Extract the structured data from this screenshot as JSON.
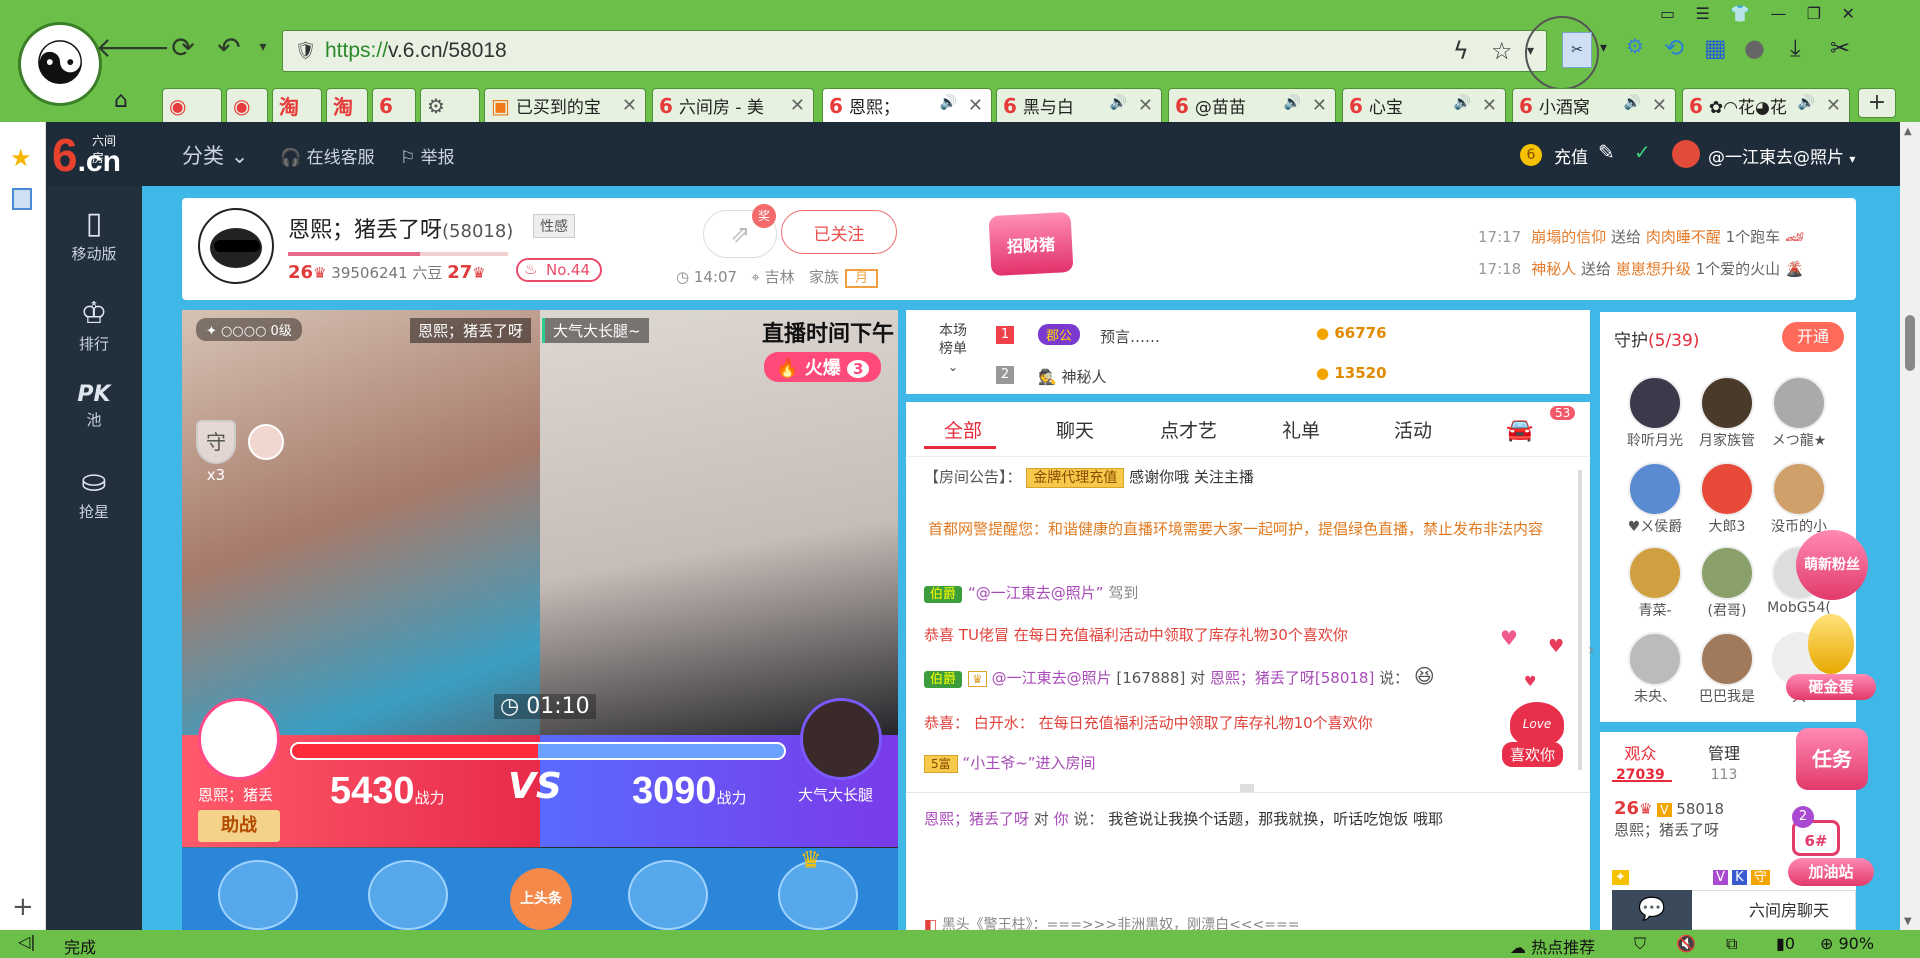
{
  "browser": {
    "url_scheme": "https://",
    "url_host": "v.6.cn/58018",
    "tabs": [
      {
        "label": "",
        "icon": "weibo-icon"
      },
      {
        "label": "",
        "icon": "weibo-icon"
      },
      {
        "label": "",
        "icon": "taobao-icon"
      },
      {
        "label": "",
        "icon": "taobao-icon"
      },
      {
        "label": "",
        "icon": "six-icon"
      },
      {
        "label": "",
        "icon": "gear-icon"
      },
      {
        "label": "已买到的宝",
        "icon": "cart-icon"
      },
      {
        "label": "六间房 - 美",
        "icon": "six-icon"
      },
      {
        "label": "恩熙；",
        "icon": "six-icon",
        "active": true
      },
      {
        "label": "黑与白",
        "icon": "six-icon"
      },
      {
        "label": "@苗苗",
        "icon": "six-icon"
      },
      {
        "label": "心宝",
        "icon": "six-icon"
      },
      {
        "label": "小酒窝",
        "icon": "six-icon"
      },
      {
        "label": "✿◠花◕花",
        "icon": "six-icon"
      }
    ],
    "new_tab": "+",
    "status_left": "完成",
    "status_hot": "热点推荐",
    "status_count": "0",
    "zoom": "90%"
  },
  "site": {
    "logo_six": "6",
    "logo_cn": ".cn",
    "logo_sub": "六间房",
    "category": "分类",
    "service": "在线客服",
    "report": "举报",
    "recharge": "充值",
    "username": "@一江東去@照片"
  },
  "left_nav": [
    {
      "label": "移动版",
      "icon": "mobile-icon"
    },
    {
      "label": "排行",
      "icon": "crown-icon"
    },
    {
      "label": "池",
      "icon": "pk-icon",
      "top": "PK"
    },
    {
      "label": "抢星",
      "icon": "bag-icon"
    }
  ],
  "anchor": {
    "name": "恩熙；猪丢了呀",
    "room_id": "(58018)",
    "tag": "性感",
    "level_num": "26",
    "beans": "39506241 六豆",
    "level2": "27",
    "rank": "No.44",
    "share_badge": "奖",
    "follow": "已关注",
    "time": "14:07",
    "location": "吉林",
    "family_label": "家族",
    "family": "月",
    "zhaocai": "招财猪"
  },
  "gift_feed": [
    {
      "time": "17:17",
      "from": "崩塌的信仰",
      "verb": "送给",
      "to": "肉肉睡不醒",
      "gift": "1个跑车"
    },
    {
      "time": "17:18",
      "from": "神秘人",
      "verb": "送给",
      "to": "崽崽想升级",
      "gift": "1个爱的火山"
    }
  ],
  "video": {
    "level_label": "0级",
    "left_name": "恩熙；猪丢了呀",
    "right_name": "大气大长腿~",
    "live_text": "直播时间下午",
    "hot": "火爆",
    "hot_num": "3",
    "guard_label": "守",
    "guard_count": "x3",
    "timer": "01:10",
    "pk_left_score": "5430",
    "pk_right_score": "3090",
    "pk_unit": "战力",
    "vs": "VS",
    "pk_left_name": "恩熙；猪丢",
    "pk_right_name": "大气大长腿",
    "help": "助战",
    "headline": "上头条",
    "pk_left_ratio": 0.5
  },
  "ranking": {
    "label": "本场榜单",
    "items": [
      {
        "num": "1",
        "badge": "郡公",
        "name": "预言……",
        "coins": "66776"
      },
      {
        "num": "2",
        "badge": "",
        "name": "神秘人",
        "coins": "13520"
      }
    ]
  },
  "chat": {
    "tabs": [
      "全部",
      "聊天",
      "点才艺",
      "礼单",
      "活动"
    ],
    "car_badge": "53",
    "notice_label": "【房间公告】：",
    "notice_badge": "金牌代理充值",
    "notice_text": "感谢你哦 关注主播",
    "warning": "首都网警提醒您：和谐健康的直播环境需要大家一起呵护，提倡绿色直播，禁止发布非法内容",
    "msg1_badge": "伯爵",
    "msg1_name": "“@一江東去@照片”",
    "msg1_text": "驾到",
    "msg2_pre": "恭喜",
    "msg2_name": "TU佬冒",
    "msg2_text": "在每日充值福利活动中领取了库存礼物30个喜欢你",
    "msg3_badge": "伯爵",
    "msg3_name": "@一江東去@照片",
    "msg3_id": "[167888]",
    "msg3_to": "对",
    "msg3_target": "恩熙；猪丢了呀[58018]",
    "msg3_say": "说：",
    "msg4_pre": "恭喜：",
    "msg4_name": "白开水：",
    "msg4_text": "在每日充值福利活动中领取了库存礼物10个喜欢你",
    "msg5_badge": "5富",
    "msg5_text": "“小王爷~”进入房间",
    "like_label": "喜欢你",
    "private_name": "恩熙；猪丢了呀",
    "private_to": "对",
    "private_you": "你",
    "private_say": "说：",
    "private_text": "我爸说让我换个话题，那我就换，听话吃饱饭 哦耶",
    "bottom_text": "黑头《警王柱》：===>>>非洲黑奴，刚漂白<<<==="
  },
  "guard_panel": {
    "title": "守护",
    "count": "(5/39)",
    "open": "开通",
    "members": [
      "聆听月光",
      "月家族管",
      "メつ龍★",
      "♥ㄨ侯爵",
      "大郎3",
      "没币的小",
      "青菜-",
      "(君哥)",
      "MobG54(",
      "未央、",
      "巴巴我是",
      "大"
    ]
  },
  "audience": {
    "tab1": "观众",
    "tab1_count": "27039",
    "tab2": "管理",
    "tab2_count": "113",
    "user_level": "26",
    "user_id": "58018",
    "user_name": "恩熙；猪丢了呀",
    "chat_float": "六间房聊天"
  },
  "side_badges": {
    "fans": "萌新粉丝",
    "egg": "砸金蛋",
    "task": "任务",
    "boost": "加油站",
    "boost_num": "6#",
    "boost_count": "2"
  }
}
